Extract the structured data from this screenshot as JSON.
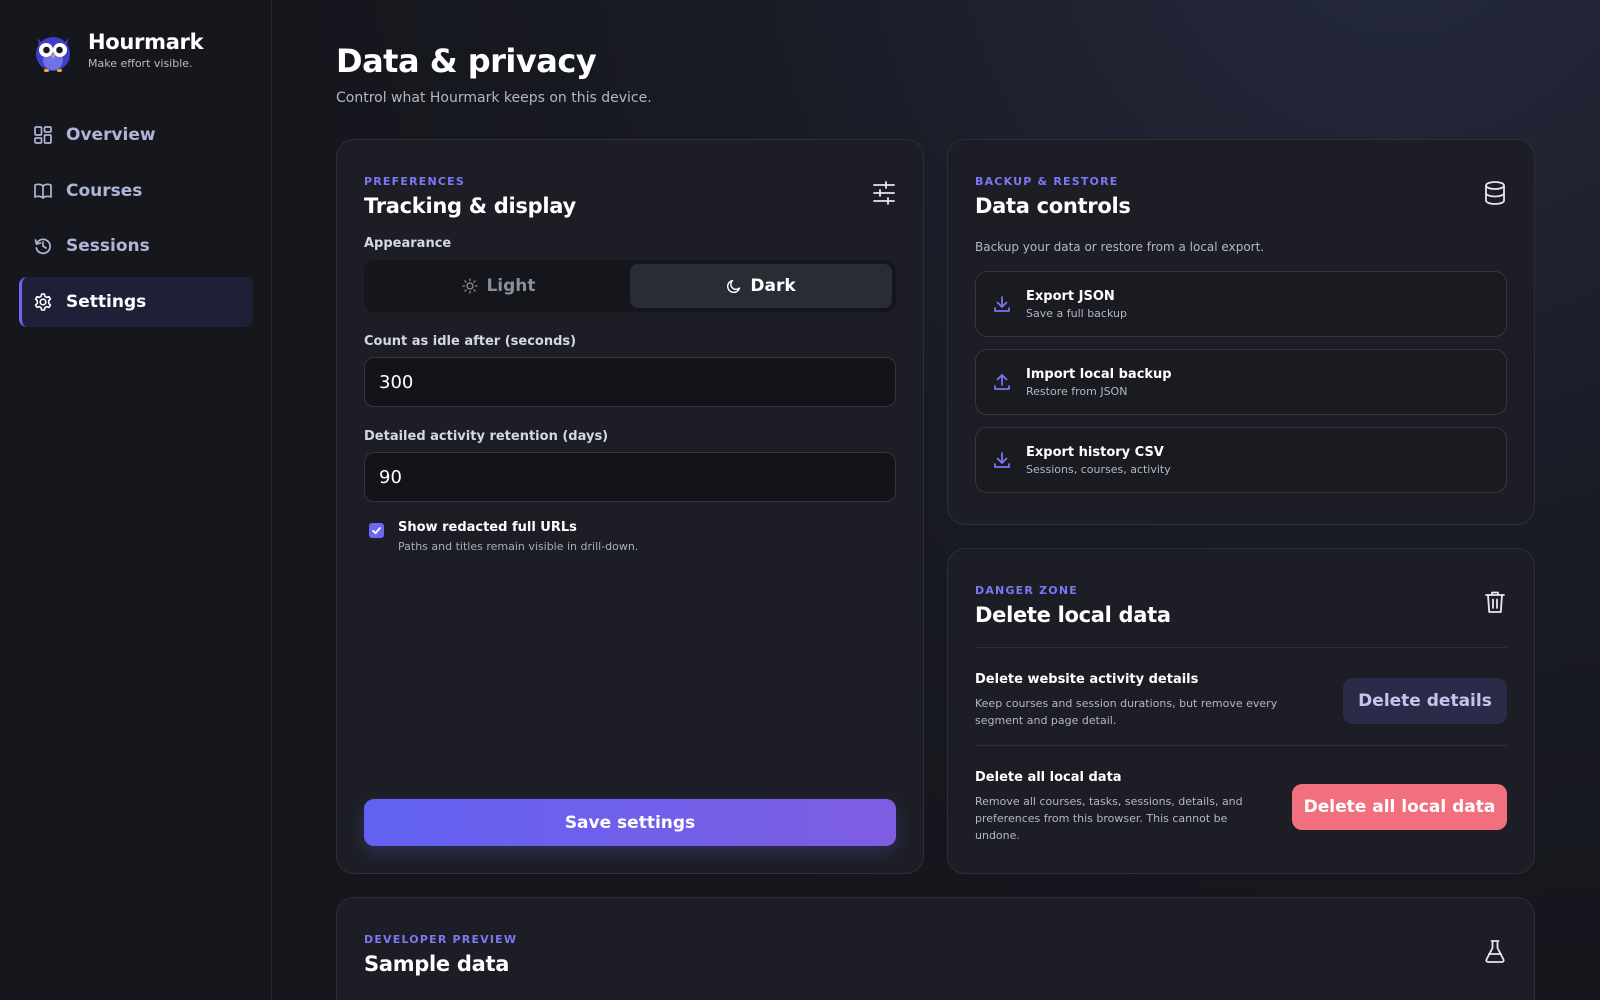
{
  "brand": {
    "name": "Hourmark",
    "tagline": "Make effort visible."
  },
  "nav": [
    {
      "label": "Overview",
      "icon": "grid-icon",
      "active": false
    },
    {
      "label": "Courses",
      "icon": "book-icon",
      "active": false
    },
    {
      "label": "Sessions",
      "icon": "history-icon",
      "active": false
    },
    {
      "label": "Settings",
      "icon": "gear-icon",
      "active": true
    }
  ],
  "page": {
    "title": "Data & privacy",
    "subtitle": "Control what Hourmark keeps on this device."
  },
  "preferences": {
    "eyebrow": "PREFERENCES",
    "title": "Tracking & display",
    "appearance_label": "Appearance",
    "theme_options": [
      "Light",
      "Dark"
    ],
    "theme_selected": "Dark",
    "idle_label": "Count as idle after (seconds)",
    "idle_value": "300",
    "retention_label": "Detailed activity retention (days)",
    "retention_value": "90",
    "show_urls_label": "Show redacted full URLs",
    "show_urls_desc": "Paths and titles remain visible in drill-down.",
    "show_urls_checked": true,
    "save_label": "Save settings"
  },
  "backup": {
    "eyebrow": "BACKUP & RESTORE",
    "title": "Data controls",
    "description": "Backup your data or restore from a local export.",
    "actions": [
      {
        "title": "Export JSON",
        "subtitle": "Save a full backup",
        "icon": "download-icon"
      },
      {
        "title": "Import local backup",
        "subtitle": "Restore from JSON",
        "icon": "upload-icon"
      },
      {
        "title": "Export history CSV",
        "subtitle": "Sessions, courses, activity",
        "icon": "download-icon"
      }
    ]
  },
  "danger": {
    "eyebrow": "DANGER ZONE",
    "title": "Delete local data",
    "details_title": "Delete website activity details",
    "details_desc": "Keep courses and session durations, but remove every segment and page detail.",
    "details_button": "Delete details",
    "all_title": "Delete all local data",
    "all_desc": "Remove all courses, tasks, sessions, details, and preferences from this browser. This cannot be undone.",
    "all_button": "Delete all local data"
  },
  "sample": {
    "eyebrow": "DEVELOPER PREVIEW",
    "title": "Sample data"
  },
  "colors": {
    "accent": "#6a68f0",
    "danger": "#f2707e",
    "background": "#15161c",
    "card": "#1d1e25"
  }
}
